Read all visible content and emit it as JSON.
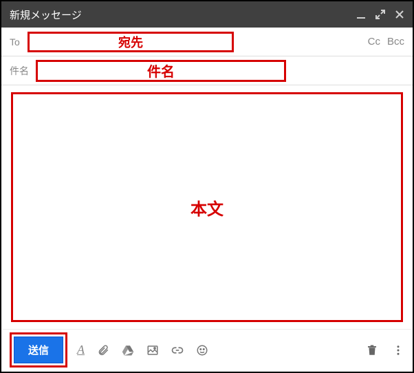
{
  "header": {
    "title": "新規メッセージ"
  },
  "to_row": {
    "label": "To",
    "cc_label": "Cc",
    "bcc_label": "Bcc"
  },
  "subject_row": {
    "label": "件名"
  },
  "annotations": {
    "to": "宛先",
    "subject": "件名",
    "body": "本文"
  },
  "toolbar": {
    "send_label": "送信",
    "font_glyph": "A"
  }
}
